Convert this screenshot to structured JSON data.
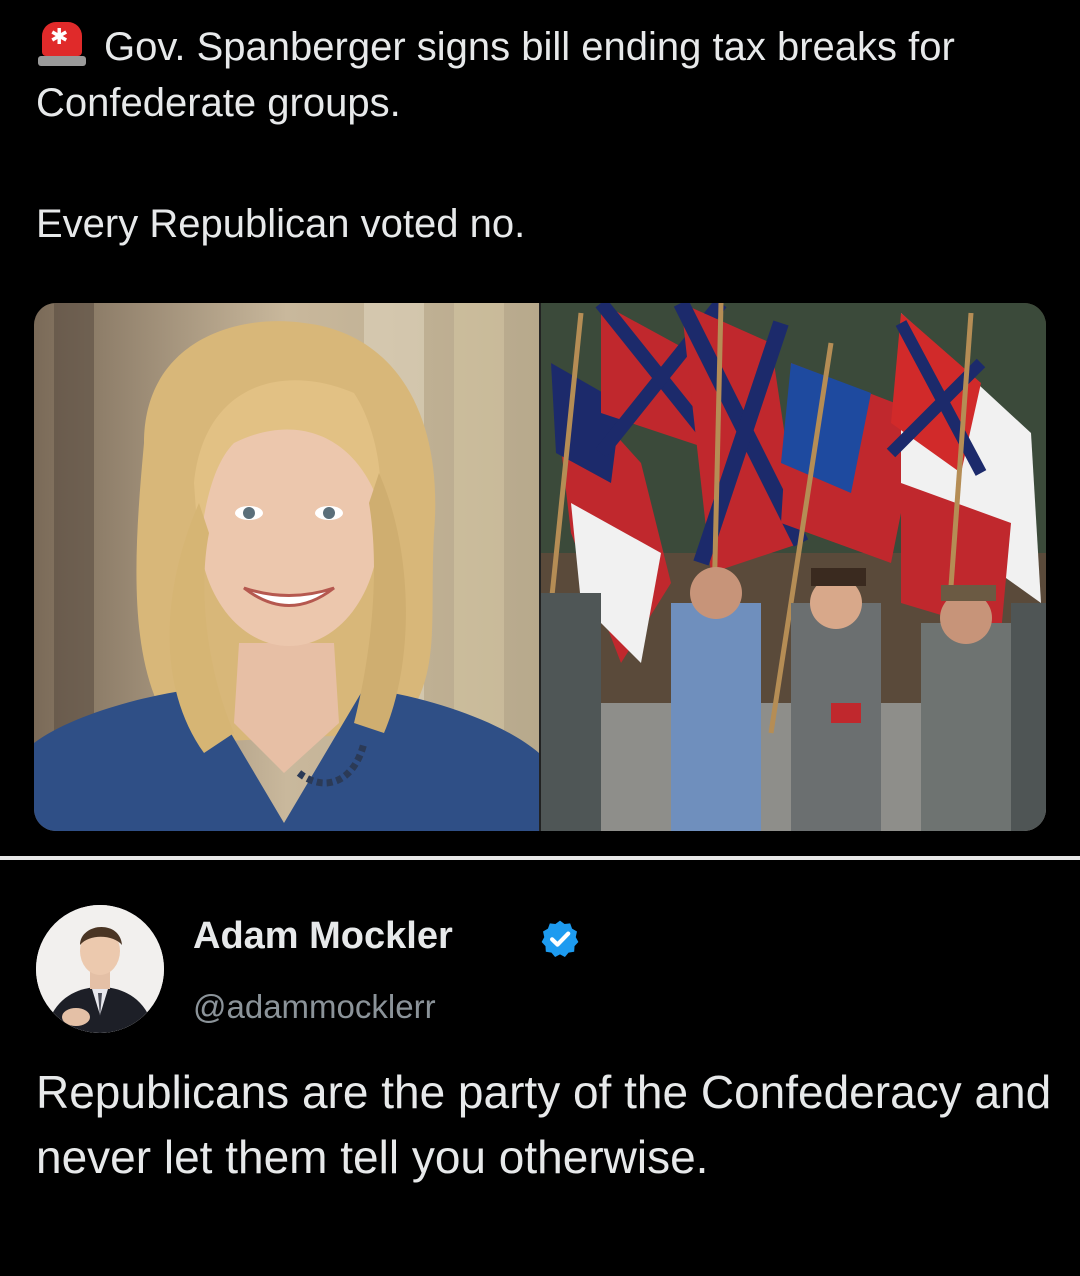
{
  "post": {
    "icon": "police-siren-icon",
    "headline": "Gov. Spanberger signs bill ending tax breaks for Confederate groups.",
    "subline": "Every Republican voted no.",
    "media": {
      "left_image": "portrait-photo",
      "right_image": "confederate-flags-march-photo"
    }
  },
  "reply": {
    "author": {
      "name": "Adam Mockler",
      "handle": "@adammocklerr",
      "verified": true,
      "badge_color": "#1d9bf0"
    },
    "text": "Republicans are the party of the Confederacy and never let them tell you otherwise."
  }
}
